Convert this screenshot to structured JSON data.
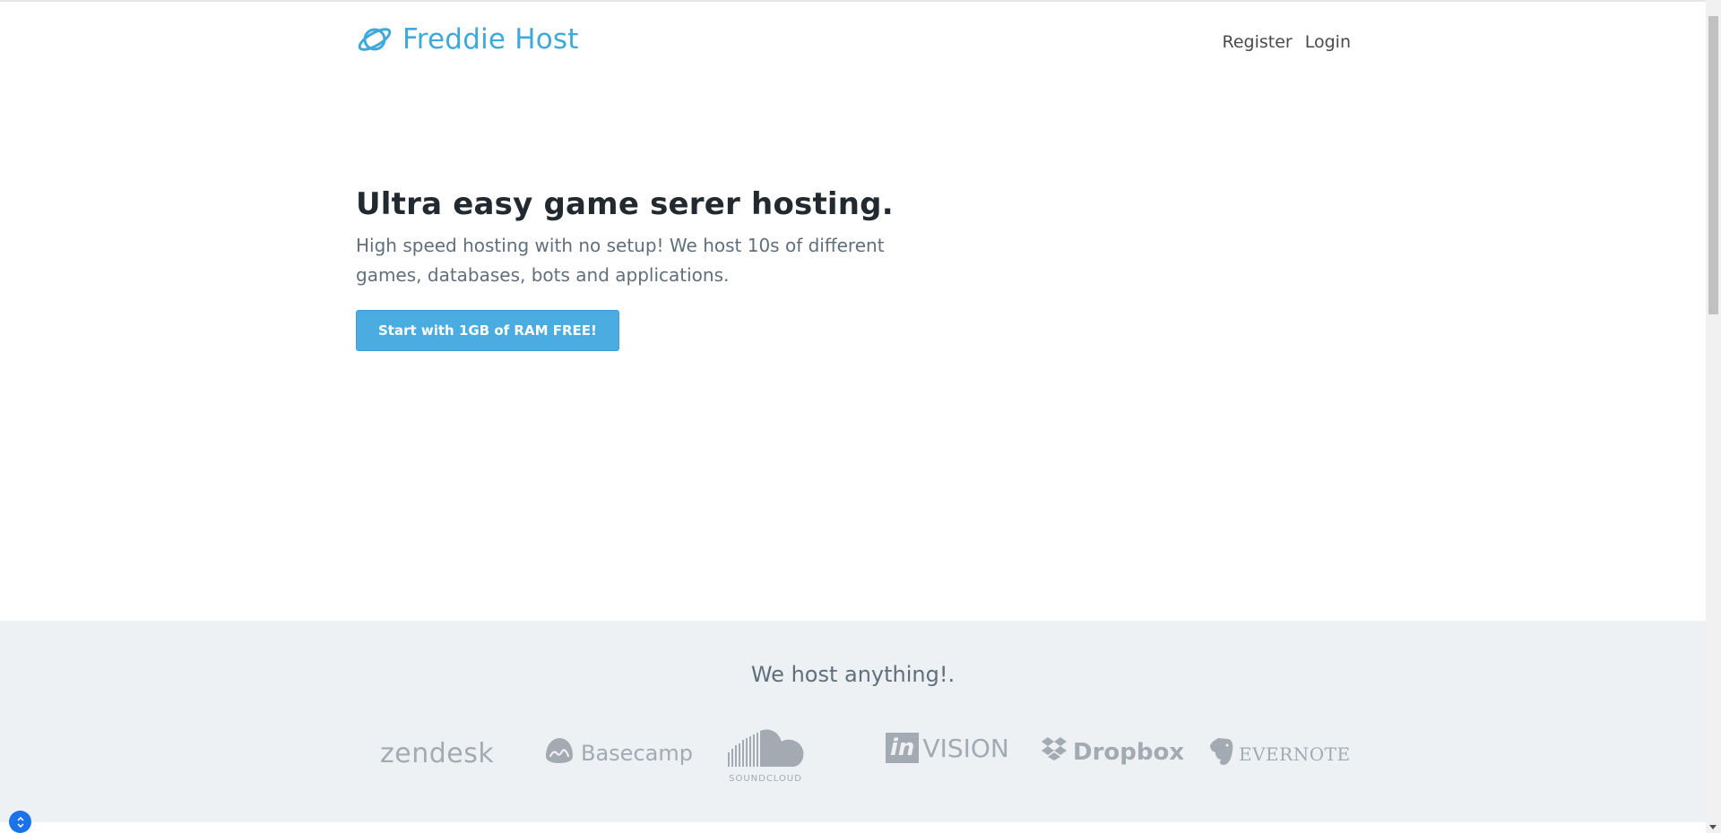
{
  "navbar": {
    "brand_name": "Freddie Host",
    "brand_icon": "planet-icon",
    "links": [
      {
        "label": "Register"
      },
      {
        "label": "Login"
      }
    ]
  },
  "hero": {
    "title": "Ultra easy game serer hosting.",
    "subtitle": "High speed hosting with no setup! We host 10s of different games, databases, bots and applications.",
    "cta_label": "Start with 1GB of RAM FREE!"
  },
  "showcase": {
    "title": "We host anything!.",
    "logos": {
      "zendesk": "zendesk",
      "basecamp": "Basecamp",
      "soundcloud": "SOUNDCLOUD",
      "invision_box": "in",
      "invision_rest": "VISION",
      "dropbox": "Dropbox",
      "evernote": "EVERNOTE"
    }
  },
  "colors": {
    "brand": "#3fa9db",
    "cta_bg": "#4aace1",
    "band_bg": "#eef1f4",
    "logo_gray": "#a3aab1"
  }
}
